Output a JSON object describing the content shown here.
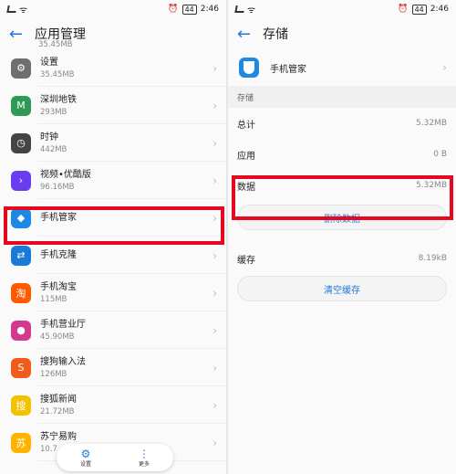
{
  "status": {
    "time": "2:46",
    "battery": "44",
    "left_icons": "▂▄▆ ᯤ"
  },
  "left": {
    "title": "应用管理",
    "back_icon": "←",
    "top_partial_size": "35.45MB",
    "apps": [
      {
        "name": "设置",
        "size": "35.45MB",
        "icon": "settings-icon",
        "color": "#6f6f6f",
        "glyph": "⚙"
      },
      {
        "name": "深圳地铁",
        "size": "293MB",
        "icon": "metro-icon",
        "color": "#2e9a55",
        "glyph": "M"
      },
      {
        "name": "时钟",
        "size": "442MB",
        "icon": "clock-icon",
        "color": "#444444",
        "glyph": "◷"
      },
      {
        "name": "视频•优酷版",
        "size": "96.16MB",
        "icon": "video-icon",
        "color": "#6a3df0",
        "glyph": "›"
      },
      {
        "name": "手机管家",
        "size": "",
        "icon": "phone-manager-icon",
        "color": "#1e88e5",
        "glyph": "◆"
      },
      {
        "name": "手机克隆",
        "size": "",
        "icon": "phone-clone-icon",
        "color": "#1a7bd6",
        "glyph": "⇄"
      },
      {
        "name": "手机淘宝",
        "size": "115MB",
        "icon": "taobao-icon",
        "color": "#ff5a00",
        "glyph": "淘"
      },
      {
        "name": "手机营业厅",
        "size": "45.90MB",
        "icon": "business-hall-icon",
        "color": "#d33a8f",
        "glyph": "●"
      },
      {
        "name": "搜狗输入法",
        "size": "126MB",
        "icon": "sogou-icon",
        "color": "#f05d1a",
        "glyph": "S"
      },
      {
        "name": "搜狐新闻",
        "size": "21.72MB",
        "icon": "sohu-news-icon",
        "color": "#f2c200",
        "glyph": "搜"
      },
      {
        "name": "苏宁易购",
        "size": "10.7",
        "icon": "suning-icon",
        "color": "#ffb300",
        "glyph": "苏"
      }
    ],
    "nav": {
      "settings": "设置",
      "more": "更多"
    }
  },
  "right": {
    "title": "存储",
    "app_name": "手机管家",
    "section": "存储",
    "rows": [
      {
        "k": "总计",
        "v": "5.32MB"
      },
      {
        "k": "应用",
        "v": "0 B"
      },
      {
        "k": "数据",
        "v": "5.32MB"
      }
    ],
    "clear_data": "删除数据",
    "cache_label": "缓存",
    "cache_value": "8.19kB",
    "clear_cache": "清空缓存"
  },
  "colors": {
    "accent": "#1e78d7",
    "highlight": "#e5081f"
  }
}
